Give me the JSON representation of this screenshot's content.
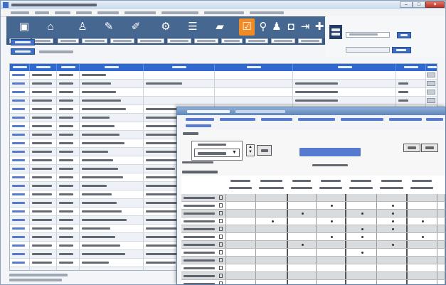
{
  "colors": {
    "toolbar_bg": "#46678f",
    "toolbar_highlight": "#f08b25",
    "grid_header": "#2f69cf",
    "button_blue": "#3c6fc4",
    "close_button": "#c2352a",
    "child_title_accent": "#3a64c8"
  },
  "toolbar": {
    "icons": [
      "monitor-icon",
      "home-icon",
      "walk-icon",
      "pen-icon",
      "brush-icon",
      "gear-icon",
      "list-icon",
      "truck-icon",
      "settings-icon",
      "search-icon",
      "user-icon",
      "car-icon",
      "export-icon",
      "plus-icon"
    ],
    "highlighted": "settings-icon"
  },
  "window": {
    "close_glyph": "×",
    "minimize_glyph": "–",
    "maximize_glyph": "□"
  },
  "child": {
    "dropdown_glyph": "▼",
    "spin_up": "▲",
    "spin_down": "▼"
  }
}
